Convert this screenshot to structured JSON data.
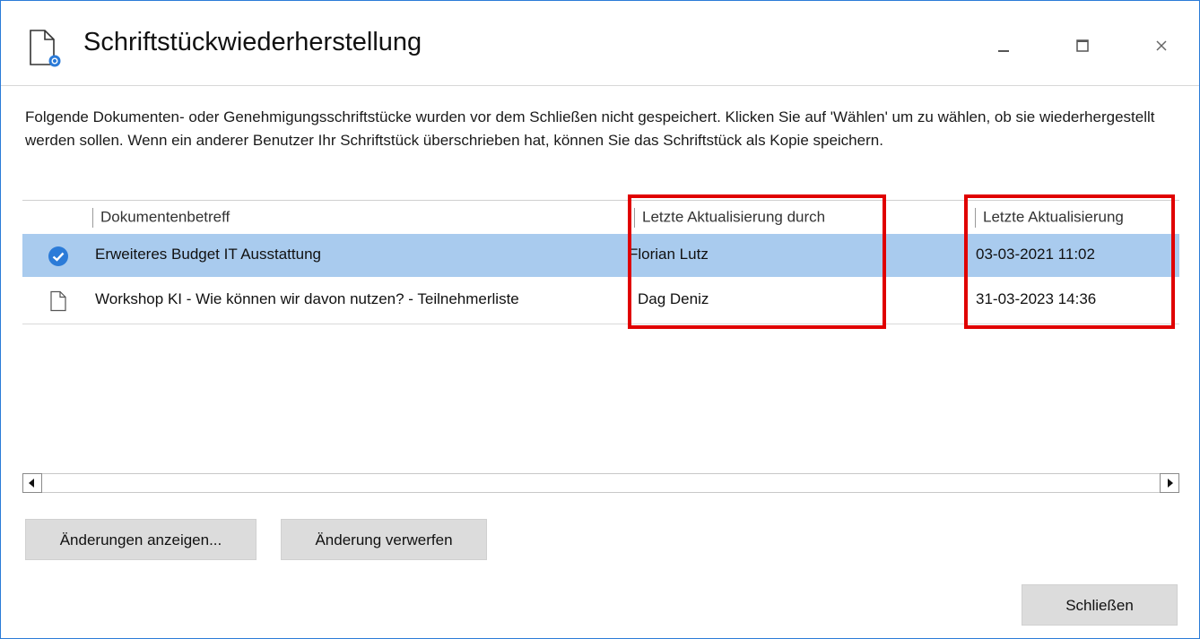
{
  "window": {
    "title": "Schriftstückwiederherstellung"
  },
  "intro_text": "Folgende Dokumenten- oder Genehmigungsschriftstücke wurden vor dem Schließen nicht gespeichert. Klicken Sie auf 'Wählen' um zu wählen, ob sie wiederhergestellt werden sollen. Wenn ein anderer Benutzer Ihr Schriftstück überschrieben hat, können Sie das Schriftstück als Kopie speichern.",
  "table": {
    "columns": [
      "Dokumentenbetreff",
      "Letzte Aktualisierung durch",
      "Letzte Aktualisierung"
    ],
    "rows": [
      {
        "subject": "Erweiteres Budget IT Ausstattung",
        "updated_by": "Florian Lutz",
        "updated_at": "03-03-2021 11:02",
        "selected": true,
        "icon": "check-circle-icon"
      },
      {
        "subject": "Workshop KI - Wie können wir davon nutzen? - Teilnehmerliste",
        "updated_by": "Dag Deniz",
        "updated_at": "31-03-2023 14:36",
        "selected": false,
        "icon": "document-icon"
      }
    ]
  },
  "buttons": {
    "show_changes": "Änderungen anzeigen...",
    "discard_change": "Änderung verwerfen",
    "close": "Schließen"
  },
  "colors": {
    "selection": "#a9cbee",
    "accent": "#2b7bd8",
    "annotation": "#e00000"
  }
}
